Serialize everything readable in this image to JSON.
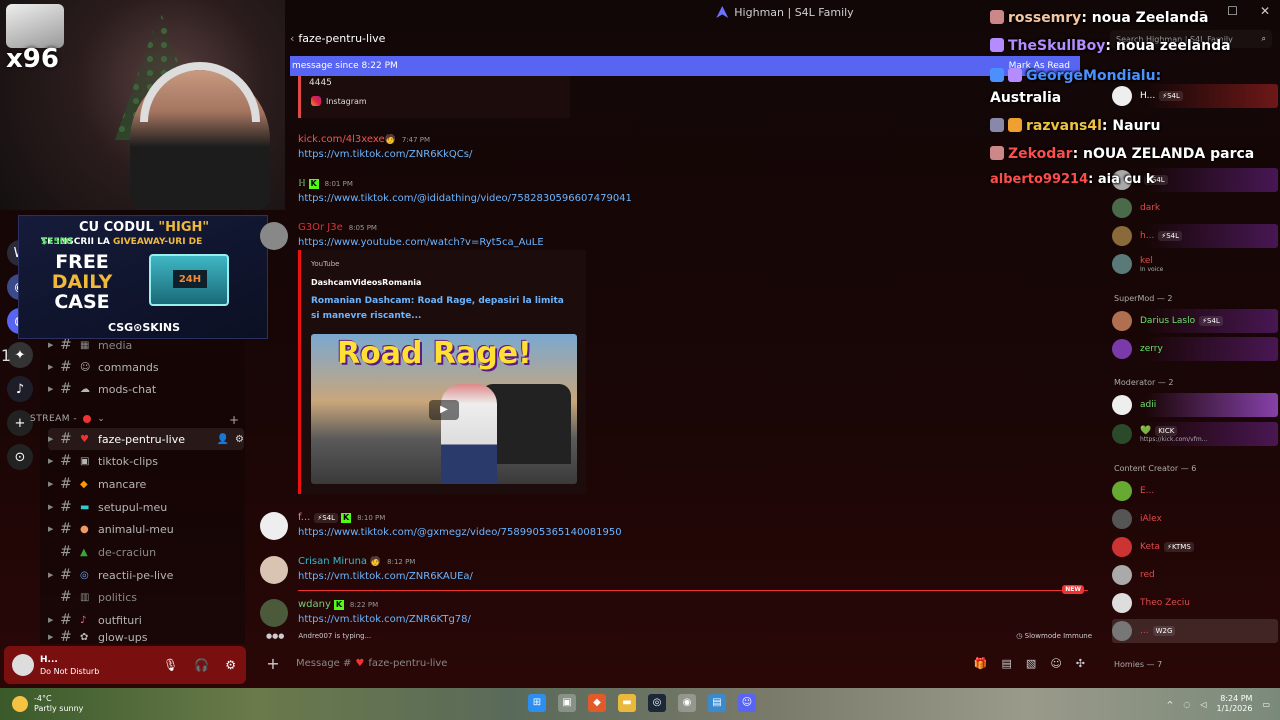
{
  "window": {
    "title": "Highman | S4L Family",
    "controls": [
      "–",
      "☐",
      "✕"
    ]
  },
  "header": {
    "channel": "faze-pentru-live"
  },
  "search": {
    "placeholder": "Search Highman | S4L Family"
  },
  "banner": {
    "text": "message since 8:22 PM",
    "action": "Mark As Read"
  },
  "webcam": {
    "overlay_text": "x96"
  },
  "promo": {
    "line1_prefix": "CU CODUL ",
    "line1_code": "\"HIGH\"",
    "line2_prefix": "TE INSCRII LA ",
    "line2_mid": "GIVEAWAY-URI DE ",
    "line2_amount": "$1500",
    "free": "FREE",
    "daily": "DAILY",
    "case": "CASE",
    "box_label": "24H",
    "brand": "CSG⊙SKINS"
  },
  "rail": {
    "badge": "1"
  },
  "sidebar": {
    "channels_top": [
      {
        "emoji": "▦",
        "label": "media",
        "dim": true
      },
      {
        "emoji": "☺",
        "label": "commands",
        "dim": false
      },
      {
        "emoji": "☁",
        "label": "mods-chat",
        "dim": false
      }
    ],
    "category": "STREAM -",
    "channels_stream": [
      {
        "emoji": "♥",
        "label": "faze-pentru-live",
        "active": true
      },
      {
        "emoji": "▣",
        "label": "tiktok-clips"
      },
      {
        "emoji": "◆",
        "label": "mancare"
      },
      {
        "emoji": "▬",
        "label": "setupul-meu"
      },
      {
        "emoji": "●",
        "label": "animalul-meu"
      },
      {
        "emoji": "▲",
        "label": "de-craciun",
        "dim": true
      },
      {
        "emoji": "◎",
        "label": "reactii-pe-live"
      },
      {
        "emoji": "▥",
        "label": "politics",
        "dim": true
      },
      {
        "emoji": "♪",
        "label": "outfituri"
      },
      {
        "emoji": "✿",
        "label": "glow-ups"
      }
    ]
  },
  "messages": {
    "embed_num": "4445",
    "embed_src": "Instagram",
    "m1": {
      "name": "kick.com/4l3xexe",
      "time": "7:47 PM",
      "link": "https://vm.tiktok.com/ZNR6KkQCs/"
    },
    "m2": {
      "name": "",
      "time": "8:01 PM",
      "link": "https://www.tiktok.com/@ididathing/video/7582830596607479041"
    },
    "m3": {
      "name": "G3Or J3e",
      "time": "8:05 PM",
      "link": "https://www.youtube.com/watch?v=Ryt5ca_AuLE"
    },
    "yt": {
      "provider": "YouTube",
      "author": "DashcamVideosRomania",
      "title": "Romanian Dashcam: Road Rage, depasiri la limita si manevre riscante...",
      "thumb_text": "Road Rage!"
    },
    "m4": {
      "name": "f...",
      "tag": "⚡S4L",
      "time": "8:10 PM",
      "link": "https://www.tiktok.com/@gxmegz/video/7589905365140081950"
    },
    "m5": {
      "name": "Crisan Miruna",
      "time": "8:12 PM",
      "link": "https://vm.tiktok.com/ZNR6KAUEa/"
    },
    "m6": {
      "name": "wdany",
      "time": "8:22 PM",
      "link": "https://vm.tiktok.com/ZNR6KTg78/"
    },
    "new_label": "NEW",
    "typing": "Andre007 is typing...",
    "slowmode": "Slowmode Immune"
  },
  "composer": {
    "placeholder": "Message #",
    "channel": "faze-pentru-live"
  },
  "user": {
    "name": "H...",
    "status": "Do Not Disturb"
  },
  "stream_chat": [
    {
      "user": "rossemry",
      "text": " noua Zeelanda",
      "color": "#f5c6a0"
    },
    {
      "user": "TheSkullBoy",
      "text": " noua zeelanda",
      "color": "#b48cff"
    },
    {
      "user": "GeorgeMondialu",
      "text": "",
      "color": "#4a90ff"
    },
    {
      "user": "",
      "text": "Australia",
      "color": "#ffffff"
    },
    {
      "user": "razvans4l",
      "text": " Nauru",
      "color": "#f0c040"
    },
    {
      "user": "Zekodar",
      "text": " nOUA ZELANDA parca",
      "color": "#ff4d4d"
    },
    {
      "user": "alberto99214",
      "text": " aia cu k",
      "color": "#ff4d4d"
    }
  ],
  "members": {
    "top": [
      {
        "name": "H...",
        "tag": "⚡S4L",
        "color": "#ffffff"
      },
      {
        "name": "",
        "tag": "⚡S4L",
        "color": "#ffffff"
      },
      {
        "name": "dark",
        "tag": "",
        "color": "#e14a4a"
      },
      {
        "name": "h...",
        "tag": "⚡S4L",
        "color": "#e14a4a"
      },
      {
        "name": "kel",
        "sub": "In voice",
        "color": "#e14a4a"
      }
    ],
    "supermod_header": "SuperMod — 2",
    "supermod": [
      {
        "name": "Darius Laslo",
        "tag": "⚡S4L",
        "color": "#6de06d"
      },
      {
        "name": "zerry",
        "tag": "",
        "color": "#6de06d"
      }
    ],
    "mod_header": "Moderator — 2",
    "mods": [
      {
        "name": "adii",
        "tag": "",
        "color": "#6de06d"
      },
      {
        "name": "💚",
        "tag": "KICK",
        "sub": "https://kick.com/vfm...",
        "color": "#6de06d"
      }
    ],
    "cc_header": "Content Creator — 6",
    "cc": [
      {
        "name": "E...",
        "tag": "",
        "color": "#e14a4a"
      },
      {
        "name": "iAlex",
        "tag": "",
        "color": "#e14a4a"
      },
      {
        "name": "Keta",
        "tag": "⚡KTMS",
        "color": "#e14a4a"
      },
      {
        "name": "red",
        "tag": "",
        "color": "#e14a4a"
      },
      {
        "name": "Theo Zeciu",
        "tag": "",
        "color": "#e14a4a"
      },
      {
        "name": "...",
        "tag": "W2G",
        "color": "#e14a4a"
      }
    ],
    "homies_header": "Homies — 7"
  },
  "taskbar": {
    "temp": "-4°C",
    "weather": "Partly sunny",
    "time": "8:24 PM",
    "date": "1/1/2026"
  }
}
